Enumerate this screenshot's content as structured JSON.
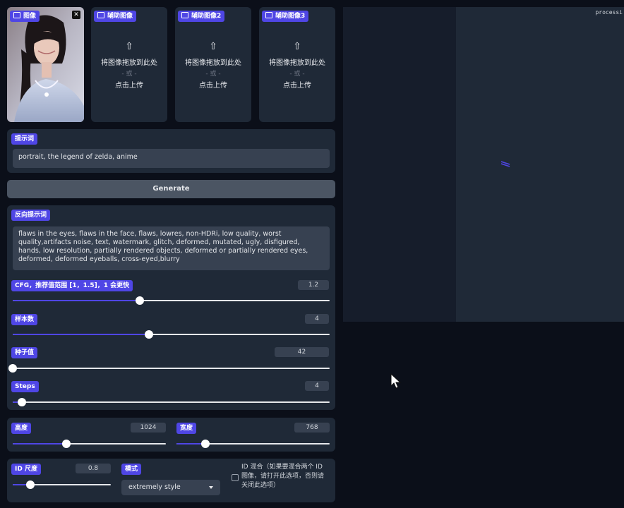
{
  "images": {
    "main_label": "图像",
    "aux1_label": "辅助图像",
    "aux2_label": "辅助图像2",
    "aux3_label": "辅助图像3",
    "drop_text": "将图像拖放到此处",
    "or_text": "- 或 -",
    "click_text": "点击上传"
  },
  "prompt": {
    "label": "提示词",
    "value": "portrait, the legend of zelda, anime"
  },
  "generate_label": "Generate",
  "negative": {
    "label": "反向提示词",
    "value": "flaws in the eyes, flaws in the face, flaws, lowres, non-HDRi, low quality, worst quality,artifacts noise, text, watermark, glitch, deformed, mutated, ugly, disfigured, hands, low resolution, partially rendered objects,  deformed or partially rendered eyes, deformed, deformed eyeballs, cross-eyed,blurry"
  },
  "sliders": {
    "cfg": {
      "label": "CFG，推荐值范围 [1，1.5]，1 会更快",
      "value": "1.2",
      "fraction": 0.4
    },
    "samples": {
      "label": "样本数",
      "value": "4",
      "fraction": 0.43
    },
    "seed": {
      "label": "种子值",
      "value": "42",
      "fraction": 0.0
    },
    "steps": {
      "label": "Steps",
      "value": "4",
      "fraction": 0.03
    },
    "height": {
      "label": "高度",
      "value": "1024",
      "fraction": 0.35
    },
    "width": {
      "label": "宽度",
      "value": "768",
      "fraction": 0.19
    },
    "id_scale": {
      "label": "ID 尺度",
      "value": "0.8",
      "fraction": 0.18
    }
  },
  "mode": {
    "label": "模式",
    "value": "extremely style"
  },
  "id_mix": {
    "label": "ID 混合（如果要混合两个 ID 图像，请打开此选项，否则请关闭此选项）",
    "checked": false
  },
  "output": {
    "status": "processi"
  },
  "colors": {
    "accent": "#4f46e5",
    "panel": "#1f2937",
    "background": "#0b0f19"
  }
}
